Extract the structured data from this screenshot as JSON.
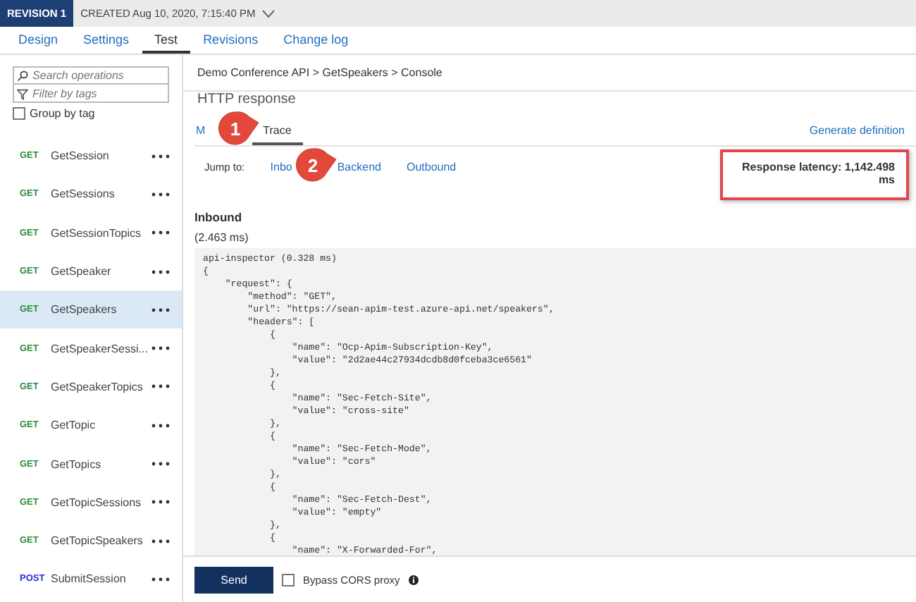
{
  "revision_bar": {
    "badge": "REVISION 1",
    "created": "CREATED Aug 10, 2020, 7:15:40 PM"
  },
  "tabs": [
    {
      "label": "Design",
      "selected": false
    },
    {
      "label": "Settings",
      "selected": false
    },
    {
      "label": "Test",
      "selected": true
    },
    {
      "label": "Revisions",
      "selected": false
    },
    {
      "label": "Change log",
      "selected": false
    }
  ],
  "sidebar": {
    "search": {
      "placeholder": "Search operations"
    },
    "filter": {
      "placeholder": "Filter by tags"
    },
    "group_by_tag": {
      "label": "Group by tag",
      "checked": false
    },
    "operations": [
      {
        "method": "GET",
        "color": "#2e8b3e",
        "name": "GetSession",
        "selected": false
      },
      {
        "method": "GET",
        "color": "#2e8b3e",
        "name": "GetSessions",
        "selected": false
      },
      {
        "method": "GET",
        "color": "#2e8b3e",
        "name": "GetSessionTopics",
        "selected": false
      },
      {
        "method": "GET",
        "color": "#2e8b3e",
        "name": "GetSpeaker",
        "selected": false
      },
      {
        "method": "GET",
        "color": "#2e8b3e",
        "name": "GetSpeakers",
        "selected": true
      },
      {
        "method": "GET",
        "color": "#2e8b3e",
        "name": "GetSpeakerSessi...",
        "selected": false
      },
      {
        "method": "GET",
        "color": "#2e8b3e",
        "name": "GetSpeakerTopics",
        "selected": false
      },
      {
        "method": "GET",
        "color": "#2e8b3e",
        "name": "GetTopic",
        "selected": false
      },
      {
        "method": "GET",
        "color": "#2e8b3e",
        "name": "GetTopics",
        "selected": false
      },
      {
        "method": "GET",
        "color": "#2e8b3e",
        "name": "GetTopicSessions",
        "selected": false
      },
      {
        "method": "GET",
        "color": "#2e8b3e",
        "name": "GetTopicSpeakers",
        "selected": false
      },
      {
        "method": "POST",
        "color": "#2a2ad8",
        "name": "SubmitSession",
        "selected": false
      }
    ]
  },
  "console": {
    "breadcrumb": "Demo Conference API > GetSpeakers > Console",
    "heading": "HTTP response",
    "response_tabs": [
      {
        "label": "M",
        "selected": false
      },
      {
        "label": "Trace",
        "selected": true
      }
    ],
    "generate_definition": "Generate definition",
    "jump_to": {
      "label": "Jump to:",
      "links": [
        "Inbo",
        "Backend",
        "Outbound"
      ]
    },
    "response_latency": "Response latency: 1,142.498 ms",
    "section_title": "Inbound",
    "section_time": "(2.463 ms)",
    "code_lines": [
      "api-inspector (0.328 ms)",
      "{",
      "    \"request\": {",
      "        \"method\": \"GET\",",
      "        \"url\": \"https://sean-apim-test.azure-api.net/speakers\",",
      "        \"headers\": [",
      "            {",
      "                \"name\": \"Ocp-Apim-Subscription-Key\",",
      "                \"value\": \"2d2ae44c27934dcdb8d0fceba3ce6561\"",
      "            },",
      "            {",
      "                \"name\": \"Sec-Fetch-Site\",",
      "                \"value\": \"cross-site\"",
      "            },",
      "            {",
      "                \"name\": \"Sec-Fetch-Mode\",",
      "                \"value\": \"cors\"",
      "            },",
      "            {",
      "                \"name\": \"Sec-Fetch-Dest\",",
      "                \"value\": \"empty\"",
      "            },",
      "            {",
      "                \"name\": \"X-Forwarded-For\","
    ],
    "send_button": "Send",
    "bypass_cors": {
      "label": "Bypass CORS proxy",
      "checked": false
    }
  },
  "callouts": [
    {
      "label": "1"
    },
    {
      "label": "2"
    }
  ]
}
